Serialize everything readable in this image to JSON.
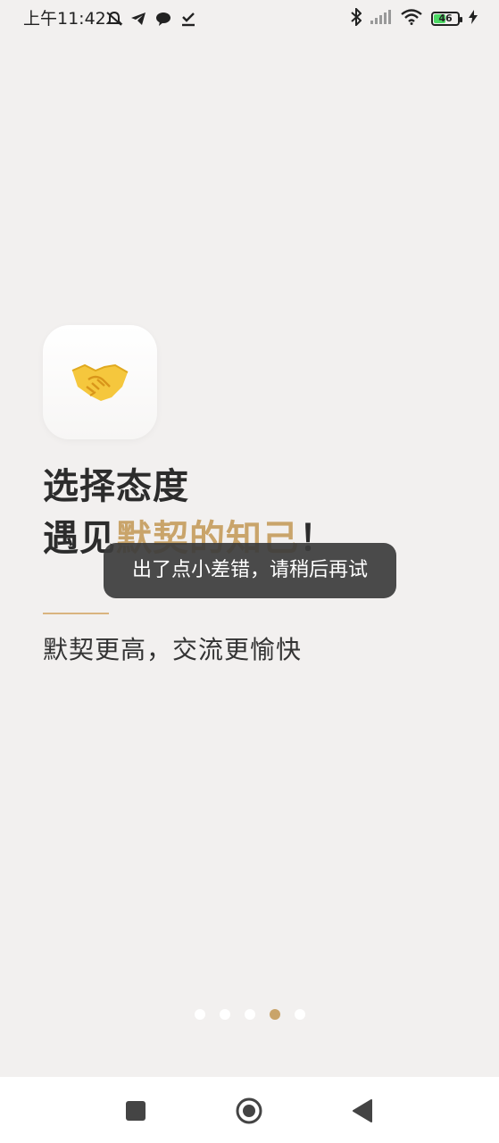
{
  "status_bar": {
    "time": "上午11:42",
    "battery_level": "46",
    "icons": [
      "mute-icon",
      "telegram-icon",
      "chat-icon",
      "download-check-icon",
      "bluetooth-icon",
      "signal-icon",
      "wifi-icon",
      "battery-icon",
      "charging-icon"
    ]
  },
  "onboarding": {
    "icon": "handshake-icon",
    "headline_line1": "选择态度",
    "headline_line2_prefix": "遇见",
    "headline_line2_accent": "默契的知己",
    "headline_line2_suffix": "！",
    "subtitle": "默契更高，交流更愉快",
    "accent_color": "#c9a46a"
  },
  "toast": {
    "message": "出了点小差错，请稍后再试"
  },
  "pager": {
    "total_pages": 5,
    "current_page": 4
  },
  "nav_bar": {
    "buttons": [
      "recents-button",
      "home-button",
      "back-button"
    ]
  }
}
